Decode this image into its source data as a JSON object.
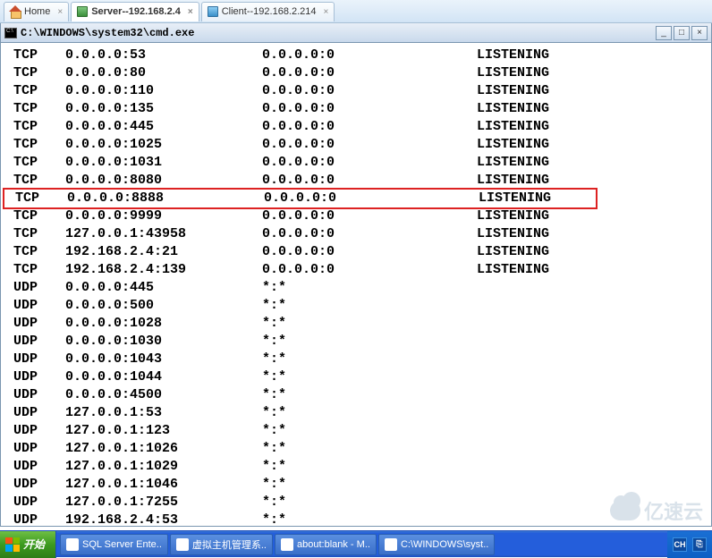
{
  "tabs": [
    {
      "label": "Home",
      "iconName": "home-icon"
    },
    {
      "label": "Server--192.168.2.4",
      "iconName": "server-icon",
      "active": true
    },
    {
      "label": "Client--192.168.2.214",
      "iconName": "client-icon"
    }
  ],
  "cmd": {
    "title": "C:\\WINDOWS\\system32\\cmd.exe",
    "minimize": "_",
    "maximize": "□",
    "close": "×"
  },
  "netstat": [
    {
      "proto": "TCP",
      "local": "0.0.0.0:53",
      "remote": "0.0.0.0:0",
      "state": "LISTENING"
    },
    {
      "proto": "TCP",
      "local": "0.0.0.0:80",
      "remote": "0.0.0.0:0",
      "state": "LISTENING"
    },
    {
      "proto": "TCP",
      "local": "0.0.0.0:110",
      "remote": "0.0.0.0:0",
      "state": "LISTENING"
    },
    {
      "proto": "TCP",
      "local": "0.0.0.0:135",
      "remote": "0.0.0.0:0",
      "state": "LISTENING"
    },
    {
      "proto": "TCP",
      "local": "0.0.0.0:445",
      "remote": "0.0.0.0:0",
      "state": "LISTENING"
    },
    {
      "proto": "TCP",
      "local": "0.0.0.0:1025",
      "remote": "0.0.0.0:0",
      "state": "LISTENING"
    },
    {
      "proto": "TCP",
      "local": "0.0.0.0:1031",
      "remote": "0.0.0.0:0",
      "state": "LISTENING"
    },
    {
      "proto": "TCP",
      "local": "0.0.0.0:8080",
      "remote": "0.0.0.0:0",
      "state": "LISTENING"
    },
    {
      "proto": "TCP",
      "local": "0.0.0.0:8888",
      "remote": "0.0.0.0:0",
      "state": "LISTENING",
      "highlighted": true
    },
    {
      "proto": "TCP",
      "local": "0.0.0.0:9999",
      "remote": "0.0.0.0:0",
      "state": "LISTENING"
    },
    {
      "proto": "TCP",
      "local": "127.0.0.1:43958",
      "remote": "0.0.0.0:0",
      "state": "LISTENING"
    },
    {
      "proto": "TCP",
      "local": "192.168.2.4:21",
      "remote": "0.0.0.0:0",
      "state": "LISTENING"
    },
    {
      "proto": "TCP",
      "local": "192.168.2.4:139",
      "remote": "0.0.0.0:0",
      "state": "LISTENING"
    },
    {
      "proto": "UDP",
      "local": "0.0.0.0:445",
      "remote": "*:*",
      "state": ""
    },
    {
      "proto": "UDP",
      "local": "0.0.0.0:500",
      "remote": "*:*",
      "state": ""
    },
    {
      "proto": "UDP",
      "local": "0.0.0.0:1028",
      "remote": "*:*",
      "state": ""
    },
    {
      "proto": "UDP",
      "local": "0.0.0.0:1030",
      "remote": "*:*",
      "state": ""
    },
    {
      "proto": "UDP",
      "local": "0.0.0.0:1043",
      "remote": "*:*",
      "state": ""
    },
    {
      "proto": "UDP",
      "local": "0.0.0.0:1044",
      "remote": "*:*",
      "state": ""
    },
    {
      "proto": "UDP",
      "local": "0.0.0.0:4500",
      "remote": "*:*",
      "state": ""
    },
    {
      "proto": "UDP",
      "local": "127.0.0.1:53",
      "remote": "*:*",
      "state": ""
    },
    {
      "proto": "UDP",
      "local": "127.0.0.1:123",
      "remote": "*:*",
      "state": ""
    },
    {
      "proto": "UDP",
      "local": "127.0.0.1:1026",
      "remote": "*:*",
      "state": ""
    },
    {
      "proto": "UDP",
      "local": "127.0.0.1:1029",
      "remote": "*:*",
      "state": ""
    },
    {
      "proto": "UDP",
      "local": "127.0.0.1:1046",
      "remote": "*:*",
      "state": ""
    },
    {
      "proto": "UDP",
      "local": "127.0.0.1:7255",
      "remote": "*:*",
      "state": ""
    },
    {
      "proto": "UDP",
      "local": "192.168.2.4:53",
      "remote": "*:*",
      "state": ""
    }
  ],
  "taskbar": {
    "start": "开始",
    "items": [
      "SQL Server Ente..",
      "虚拟主机管理系..",
      "about:blank - M..",
      "C:\\WINDOWS\\syst.."
    ],
    "trayLabel": "CH"
  },
  "watermark": "亿速云"
}
